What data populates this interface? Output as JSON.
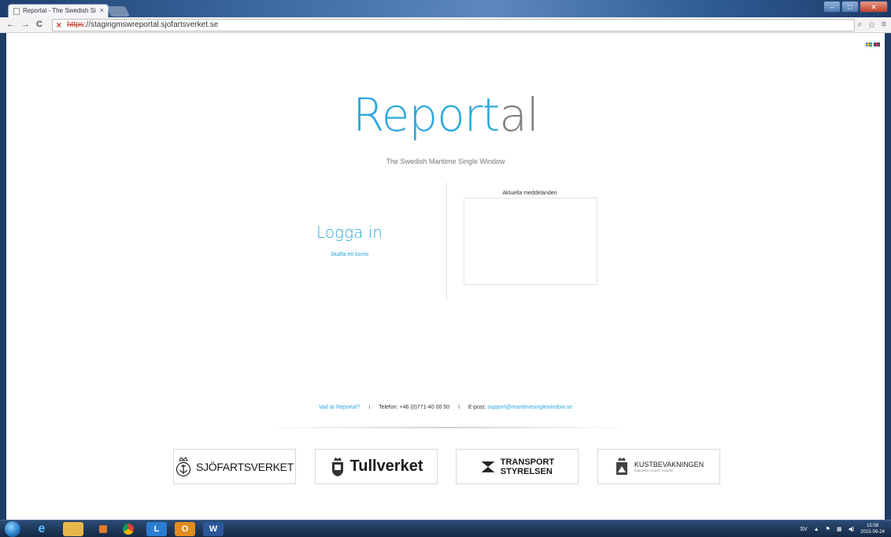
{
  "browser": {
    "tab_title": "Reportal - The Swedish Si",
    "tab_close": "×",
    "url_scheme": "https",
    "url_rest": "://stagingmswreportal.sjofartsverket.se",
    "back_icon": "←",
    "forward_icon": "→",
    "reload_icon": "C",
    "zoom_icon": "⌕",
    "star_icon": "☆",
    "menu_icon": "≡"
  },
  "page": {
    "logo_part1": "Report",
    "logo_part2": "al",
    "tagline": "The Swedish Maritime Single Window",
    "login_title": "Logga in",
    "create_account": "Skaffa ett konto",
    "news_title": "Aktuella meddelanden",
    "footer": {
      "what_is": "Vad är Reportal?",
      "sep": "I",
      "phone": "Telefon: +46 (0)771-40 00 50",
      "email_label": "E-post:",
      "email": "support@maritimesinglewindow.se"
    },
    "partners": {
      "p1": "SJÖFARTSVERKET",
      "p2": "Tullverket",
      "p3_line1": "TRANSPORT",
      "p3_line2": "STYRELSEN",
      "p4": "KUSTBEVAKNINGEN",
      "p4_sub": "SWEDISH COAST GUARD"
    }
  },
  "taskbar": {
    "lang": "SV",
    "time": "15:08",
    "date": "2015-09-24"
  },
  "colors": {
    "accent": "#2ea8dc",
    "logo_gray": "#7b8086"
  }
}
